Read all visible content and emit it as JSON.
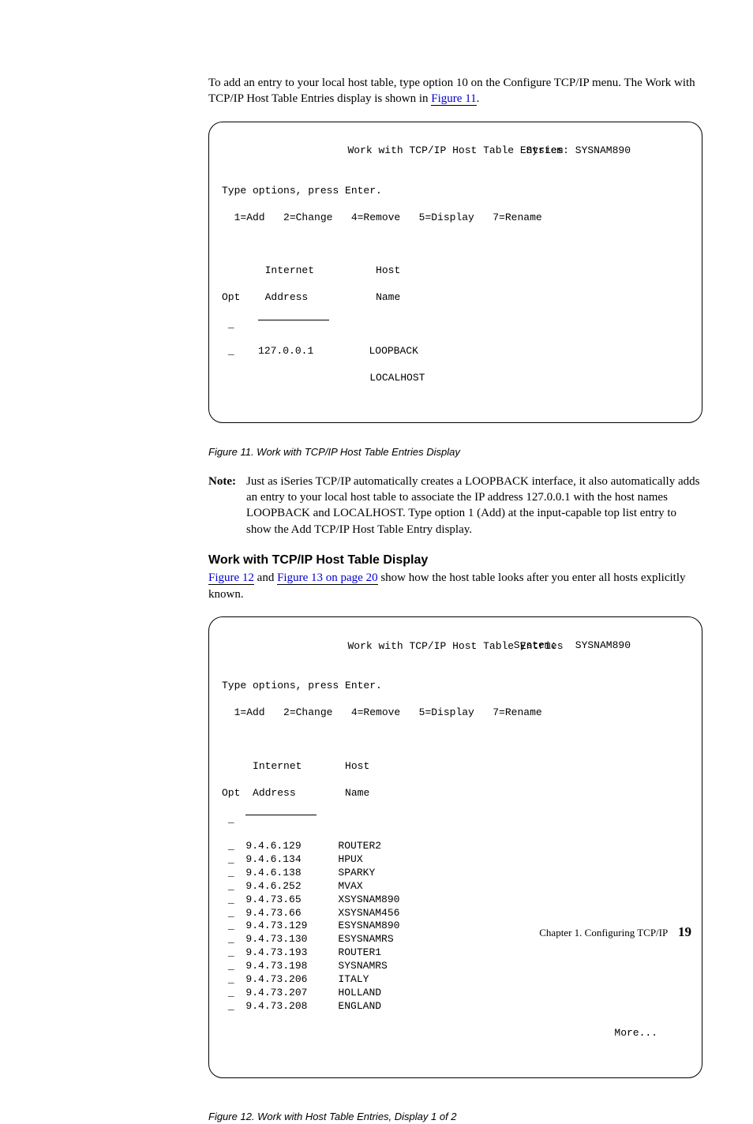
{
  "intro": {
    "text_a": "To add an entry to your local host table, type option 10 on the Configure TCP/IP menu. The Work with TCP/IP Host Table Entries display is shown in ",
    "link_fig11": "Figure 11",
    "text_b": "."
  },
  "screen1": {
    "title": "Work with TCP/IP Host Table Entries",
    "system_label": "System:",
    "system_value": "SYSNAM890",
    "instruct": "Type options, press Enter.",
    "opts": "  1=Add   2=Change   4=Remove   5=Display   7=Rename",
    "col_opt": "Opt",
    "col_addr1": "Internet",
    "col_addr2": "Address",
    "col_host1": "Host",
    "col_host2": "Name",
    "opt_underscore": "_",
    "row_ip": "127.0.0.1",
    "row_name1": "LOOPBACK",
    "row_name2": "LOCALHOST"
  },
  "fig11_caption": "Figure 11. Work with TCP/IP Host Table Entries Display",
  "note": {
    "label": "Note:",
    "body": "Just as iSeries TCP/IP automatically creates a LOOPBACK interface, it also automatically adds an entry to your local host table to associate the IP address 127.0.0.1 with the host names LOOPBACK and LOCALHOST. Type option 1 (Add) at the input-capable top list entry to show the Add TCP/IP Host Table Entry display."
  },
  "section_title": "Work with TCP/IP Host Table Display",
  "section_para": {
    "link_fig12": "Figure 12",
    "mid": " and ",
    "link_fig13": "Figure 13 on page 20",
    "rest": " show how the host table looks after you enter all hosts explicitly known."
  },
  "screen2": {
    "title": "Work with TCP/IP Host Table Entries",
    "system_label": "System:",
    "system_value": "SYSNAM890",
    "instruct": "Type options, press Enter.",
    "opts": "  1=Add   2=Change   4=Remove   5=Display   7=Rename",
    "col_opt": "Opt",
    "col_addr1": "Internet",
    "col_addr2": "Address",
    "col_host1": "Host",
    "col_host2": "Name",
    "opt_underscore": "_",
    "rows": [
      {
        "ip": "9.4.6.129",
        "name": "ROUTER2"
      },
      {
        "ip": "9.4.6.134",
        "name": "HPUX"
      },
      {
        "ip": "9.4.6.138",
        "name": "SPARKY"
      },
      {
        "ip": "9.4.6.252",
        "name": "MVAX"
      },
      {
        "ip": "9.4.73.65",
        "name": "XSYSNAM890"
      },
      {
        "ip": "9.4.73.66",
        "name": "XSYSNAM456"
      },
      {
        "ip": "9.4.73.129",
        "name": "ESYSNAM890"
      },
      {
        "ip": "9.4.73.130",
        "name": "ESYSNAMRS"
      },
      {
        "ip": "9.4.73.193",
        "name": "ROUTER1"
      },
      {
        "ip": "9.4.73.198",
        "name": "SYSNAMRS"
      },
      {
        "ip": "9.4.73.206",
        "name": "ITALY"
      },
      {
        "ip": "9.4.73.207",
        "name": "HOLLAND"
      },
      {
        "ip": "9.4.73.208",
        "name": "ENGLAND"
      }
    ],
    "more": "More..."
  },
  "fig12_caption": "Figure 12. Work with Host Table Entries, Display 1 of 2",
  "footer": {
    "chapter": "Chapter 1. Configuring TCP/IP",
    "page": "19"
  }
}
